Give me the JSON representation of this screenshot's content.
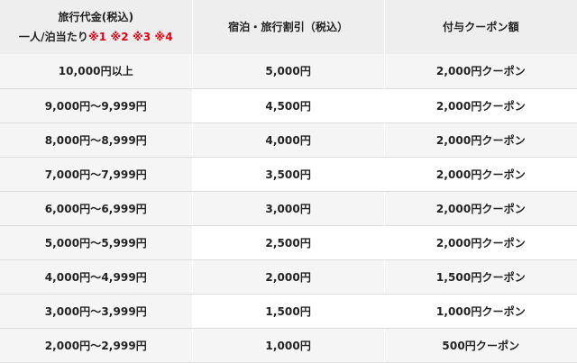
{
  "header": {
    "col1_line1": "旅行代金(税込)",
    "col1_line2_prefix": "一人/泊当たり",
    "col1_notes": [
      "※1",
      "※2",
      "※3",
      "※4"
    ],
    "col2": "宿泊・旅行割引（税込）",
    "col3": "付与クーポン額"
  },
  "rows": [
    {
      "price": "10,000円以上",
      "discount": "5,000円",
      "coupon": "2,000円クーポン"
    },
    {
      "price": "9,000円〜9,999円",
      "discount": "4,500円",
      "coupon": "2,000円クーポン"
    },
    {
      "price": "8,000円〜8,999円",
      "discount": "4,000円",
      "coupon": "2,000円クーポン"
    },
    {
      "price": "7,000円〜7,999円",
      "discount": "3,500円",
      "coupon": "2,000円クーポン"
    },
    {
      "price": "6,000円〜6,999円",
      "discount": "3,000円",
      "coupon": "2,000円クーポン"
    },
    {
      "price": "5,000円〜5,999円",
      "discount": "2,500円",
      "coupon": "2,000円クーポン"
    },
    {
      "price": "4,000円〜4,999円",
      "discount": "2,000円",
      "coupon": "1,500円クーポン"
    },
    {
      "price": "3,000円〜3,999円",
      "discount": "1,500円",
      "coupon": "1,000円クーポン"
    },
    {
      "price": "2,000円〜2,999円",
      "discount": "1,000円",
      "coupon": "500円クーポン"
    }
  ],
  "colors": {
    "note": "#e60012",
    "header_bg": "#eeeeee",
    "row_shade": "#f5f5f5",
    "divider": "#dddddd"
  }
}
